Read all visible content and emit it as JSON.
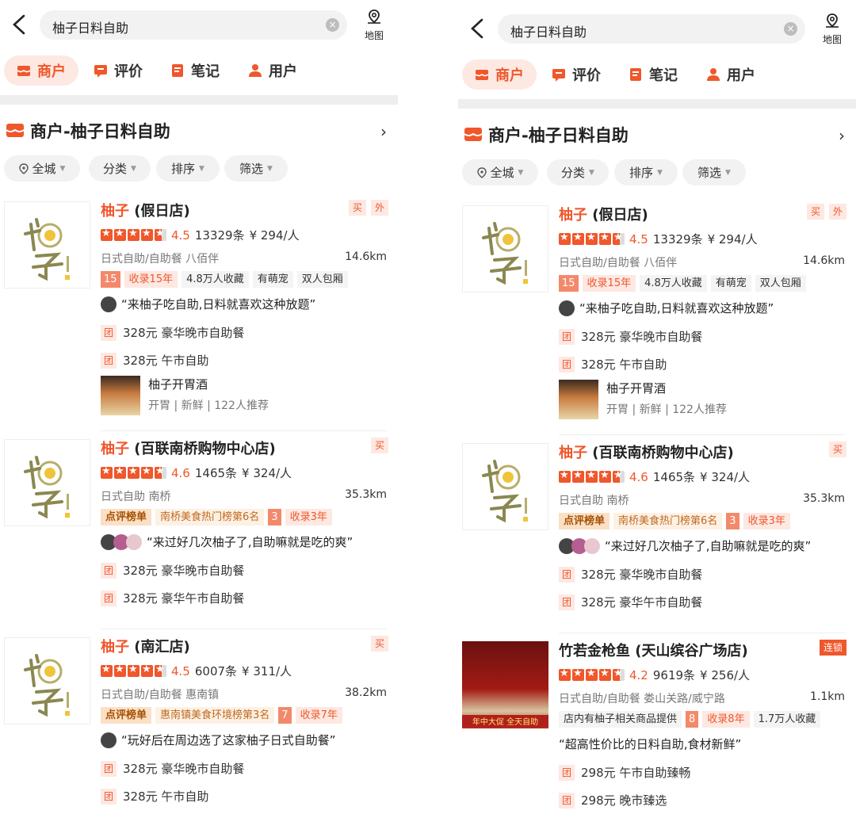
{
  "search": {
    "query": "柚子日料自助",
    "clear_glyph": "×",
    "map_label": "地图"
  },
  "tabs": [
    {
      "label": "商户"
    },
    {
      "label": "评价"
    },
    {
      "label": "笔记"
    },
    {
      "label": "用户"
    }
  ],
  "section_title": "商户-柚子日料自助",
  "filters": [
    {
      "label": "全城"
    },
    {
      "label": "分类"
    },
    {
      "label": "排序"
    },
    {
      "label": "筛选"
    }
  ],
  "colors": {
    "accent": "#f0572b",
    "light": "#fde8e2"
  },
  "left_cards": [
    {
      "name_hl": "柚子",
      "name_rest": " (假日店)",
      "badges": [
        "买",
        "外"
      ],
      "score": "4.5",
      "reviews": "13329条",
      "price": "¥ 294/人",
      "category": "日式自助/自助餐  八佰伴",
      "distance": "14.6km",
      "tags": [
        {
          "t": "15",
          "k": "num"
        },
        {
          "t": "收录15年",
          "k": "orange"
        },
        {
          "t": "4.8万人收藏",
          "k": ""
        },
        {
          "t": "有萌宠",
          "k": ""
        },
        {
          "t": "双人包厢",
          "k": ""
        }
      ],
      "review": "“来柚子吃自助,日料就喜欢这种放题”",
      "deals": [
        "328元 豪华晚市自助餐",
        "328元 午市自助"
      ],
      "dish": {
        "title": "柚子开胃酒",
        "meta": "开胃 | 新鲜 | 122人推荐"
      }
    },
    {
      "name_hl": "柚子",
      "name_rest": " (百联南桥购物中心店)",
      "badges": [
        "买"
      ],
      "score": "4.6",
      "reviews": "1465条",
      "price": "¥ 324/人",
      "category": "日式自助  南桥",
      "distance": "35.3km",
      "tags": [
        {
          "t": "点评榜单",
          "k": "rank"
        },
        {
          "t": "南桥美食热门榜第6名",
          "k": "rank2"
        },
        {
          "t": "3",
          "k": "num"
        },
        {
          "t": "收录3年",
          "k": "orange"
        }
      ],
      "review": "“来过好几次柚子了,自助嘛就是吃的爽”",
      "deals": [
        "328元 豪华晚市自助餐",
        "328元 豪华午市自助餐"
      ]
    },
    {
      "name_hl": "柚子",
      "name_rest": " (南汇店)",
      "badges": [
        "买"
      ],
      "score": "4.5",
      "reviews": "6007条",
      "price": "¥ 311/人",
      "category": "日式自助/自助餐  惠南镇",
      "distance": "38.2km",
      "tags": [
        {
          "t": "点评榜单",
          "k": "rank"
        },
        {
          "t": "惠南镇美食环境榜第3名",
          "k": "rank2"
        },
        {
          "t": "7",
          "k": "num"
        },
        {
          "t": "收录7年",
          "k": "orange"
        }
      ],
      "review": "“玩好后在周边选了这家柚子日式自助餐”",
      "deals": [
        "328元 豪华晚市自助餐",
        "328元 午市自助"
      ]
    }
  ],
  "right_extra_card": {
    "name_hl": "",
    "name_rest": "竹若金枪鱼 (天山缤谷广场店)",
    "badges": [
      "连锁"
    ],
    "score": "4.2",
    "reviews": "9619条",
    "price": "¥ 256/人",
    "category": "日式自助/自助餐  娄山关路/威宁路",
    "distance": "1.1km",
    "tags": [
      {
        "t": "店内有柚子相关商品提供",
        "k": ""
      },
      {
        "t": "8",
        "k": "num"
      },
      {
        "t": "收录8年",
        "k": "orange"
      },
      {
        "t": "1.7万人收藏",
        "k": ""
      }
    ],
    "review": "“超高性价比的日料自助,食材新鲜”",
    "deals": [
      "298元 午市自助臻畅",
      "298元 晚市臻选"
    ],
    "banner": "年中大促 全天自助"
  },
  "tuan_label": "团"
}
